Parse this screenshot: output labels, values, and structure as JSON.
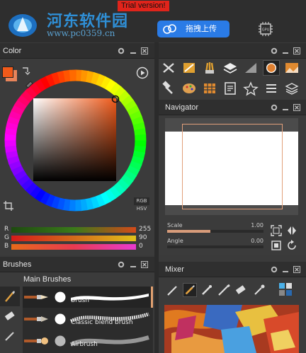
{
  "watermark": {
    "site_name": "河东软件园",
    "url": "www.pc0359.cn"
  },
  "trial_badge": "Trial version!",
  "upload_button": {
    "label": "拖拽上传"
  },
  "gpu_label": "GPU",
  "panels": {
    "color": {
      "title": "Color"
    },
    "brushes": {
      "title": "Brushes"
    },
    "navigator": {
      "title": "Navigator"
    },
    "mixer": {
      "title": "Mixer"
    }
  },
  "color": {
    "mode_primary": "RGB",
    "mode_secondary": "HSV",
    "primary_color": "#f05a1a",
    "secondary_color": "#e8845a",
    "channels": [
      {
        "label": "R",
        "value": "255",
        "fill": "#d44a1a"
      },
      {
        "label": "G",
        "value": "90",
        "fill": "#d4a41a"
      },
      {
        "label": "B",
        "value": "0",
        "fill": "#e03060"
      }
    ]
  },
  "navigator": {
    "scale_label": "Scale",
    "scale_value": "1.00",
    "angle_label": "Angle",
    "angle_value": "0.00",
    "scale_fraction": 0.45,
    "angle_fraction": 0.0
  },
  "brushes": {
    "group_label": "Main Brushes",
    "items": [
      {
        "name": "Brush"
      },
      {
        "name": "Classic blend brush"
      },
      {
        "name": "Airbrush"
      }
    ]
  },
  "tools": {
    "row1": [
      "pan-tool-icon",
      "eyedropper-brush-icon",
      "hand-brushes-icon",
      "layers-icon",
      "gradient-icon",
      "color-circle-icon",
      "image-icon"
    ],
    "row2": [
      "hammer-icon",
      "palette-icon",
      "grid-icon",
      "document-icon",
      "star-icon",
      "list-icon",
      "layers-stack-icon"
    ]
  }
}
